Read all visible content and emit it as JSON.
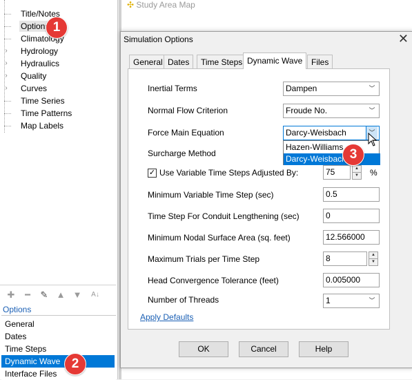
{
  "left_panel": {
    "tree_items": [
      {
        "label": "Title/Notes",
        "expandable": false
      },
      {
        "label": "Options",
        "expandable": false
      },
      {
        "label": "Climatology",
        "expandable": false
      },
      {
        "label": "Hydrology",
        "expandable": true
      },
      {
        "label": "Hydraulics",
        "expandable": true
      },
      {
        "label": "Quality",
        "expandable": true
      },
      {
        "label": "Curves",
        "expandable": true
      },
      {
        "label": "Time Series",
        "expandable": false
      },
      {
        "label": "Time Patterns",
        "expandable": false
      },
      {
        "label": "Map Labels",
        "expandable": false
      }
    ],
    "options_header": "Options",
    "options_items": [
      "General",
      "Dates",
      "Time Steps",
      "Dynamic Wave",
      "Interface Files"
    ]
  },
  "map_window": {
    "title": "Study Area Map"
  },
  "dialog": {
    "title": "Simulation Options",
    "close_glyph": "✕",
    "tabs": [
      "General",
      "Dates",
      "Time Steps",
      "Dynamic Wave",
      "Files"
    ],
    "active_tab": "Dynamic Wave",
    "fields": {
      "inertial_terms": {
        "label": "Inertial Terms",
        "value": "Dampen"
      },
      "normal_flow": {
        "label": "Normal Flow Criterion",
        "value": "Froude No."
      },
      "force_main": {
        "label": "Force Main Equation",
        "value": "Darcy-Weisbach"
      },
      "surcharge": {
        "label": "Surcharge Method"
      },
      "variable_steps": {
        "label": "Use Variable Time Steps Adjusted By:",
        "value": "75",
        "unit": "%",
        "checked": true
      },
      "min_step": {
        "label": "Minimum Variable Time Step (sec)",
        "value": "0.5"
      },
      "lengthening": {
        "label": "Time Step For Conduit Lengthening (sec)",
        "value": "0"
      },
      "min_area": {
        "label": "Minimum Nodal Surface Area (sq. feet)",
        "value": "12.566000"
      },
      "max_trials": {
        "label": "Maximum Trials per Time Step",
        "value": "8"
      },
      "head_tol": {
        "label": "Head Convergence Tolerance (feet)",
        "value": "0.005000"
      },
      "threads": {
        "label": "Number of Threads",
        "value": "1"
      }
    },
    "dropdown_options": [
      "Hazen-Williams",
      "Darcy-Weisbach"
    ],
    "apply_defaults": "Apply Defaults",
    "buttons": {
      "ok": "OK",
      "cancel": "Cancel",
      "help": "Help"
    }
  },
  "callouts": [
    "1",
    "2",
    "3"
  ],
  "colors": {
    "selection": "#0078d7",
    "callout": "#e53935",
    "link": "#1a5fb4"
  }
}
